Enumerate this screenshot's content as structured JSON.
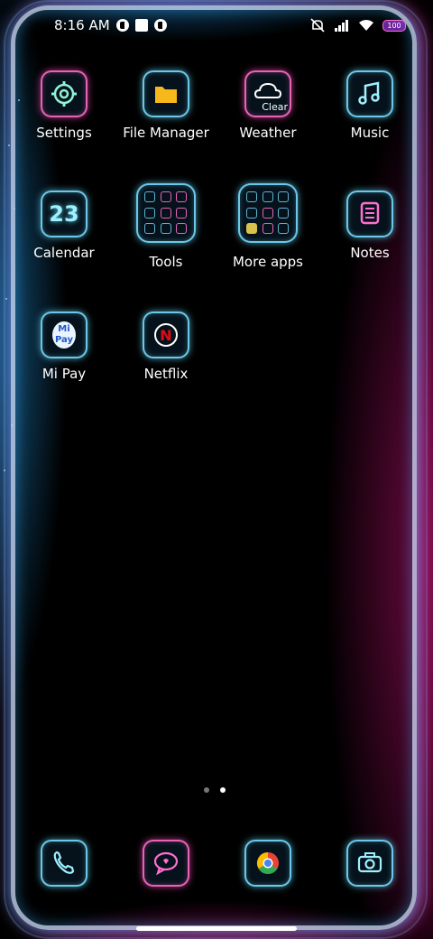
{
  "status_bar": {
    "time": "8:16 AM",
    "battery": "100",
    "icons": [
      "notification-icon-1",
      "notification-square-icon",
      "notification-icon-2",
      "silent-icon",
      "signal-icon",
      "wifi-icon",
      "battery-icon"
    ]
  },
  "apps": [
    {
      "label": "Settings",
      "icon": "gear-icon"
    },
    {
      "label": "File Manager",
      "icon": "folder-icon"
    },
    {
      "label": "Weather",
      "icon": "cloud-icon",
      "badge": "Clear"
    },
    {
      "label": "Music",
      "icon": "music-note-icon"
    },
    {
      "label": "Calendar",
      "icon": "calendar-icon",
      "glyph": "23"
    },
    {
      "label": "Tools",
      "icon": "folder-icon"
    },
    {
      "label": "More apps",
      "icon": "folder-icon"
    },
    {
      "label": "Notes",
      "icon": "notes-icon"
    },
    {
      "label": "Mi Pay",
      "icon": "mi-pay-icon",
      "glyph_top": "Mi",
      "glyph_bottom": "Pay"
    },
    {
      "label": "Netflix",
      "icon": "netflix-icon",
      "glyph": "N"
    }
  ],
  "dock": [
    {
      "label": "Phone",
      "icon": "phone-icon"
    },
    {
      "label": "Messages",
      "icon": "message-icon"
    },
    {
      "label": "Chrome",
      "icon": "chrome-icon"
    },
    {
      "label": "Camera",
      "icon": "camera-icon"
    }
  ],
  "page_indicator": {
    "pages": 2,
    "current": 2
  },
  "colors": {
    "neon_cyan": "#7fe3ff",
    "neon_pink": "#ff5fc8",
    "background": "#000000"
  }
}
